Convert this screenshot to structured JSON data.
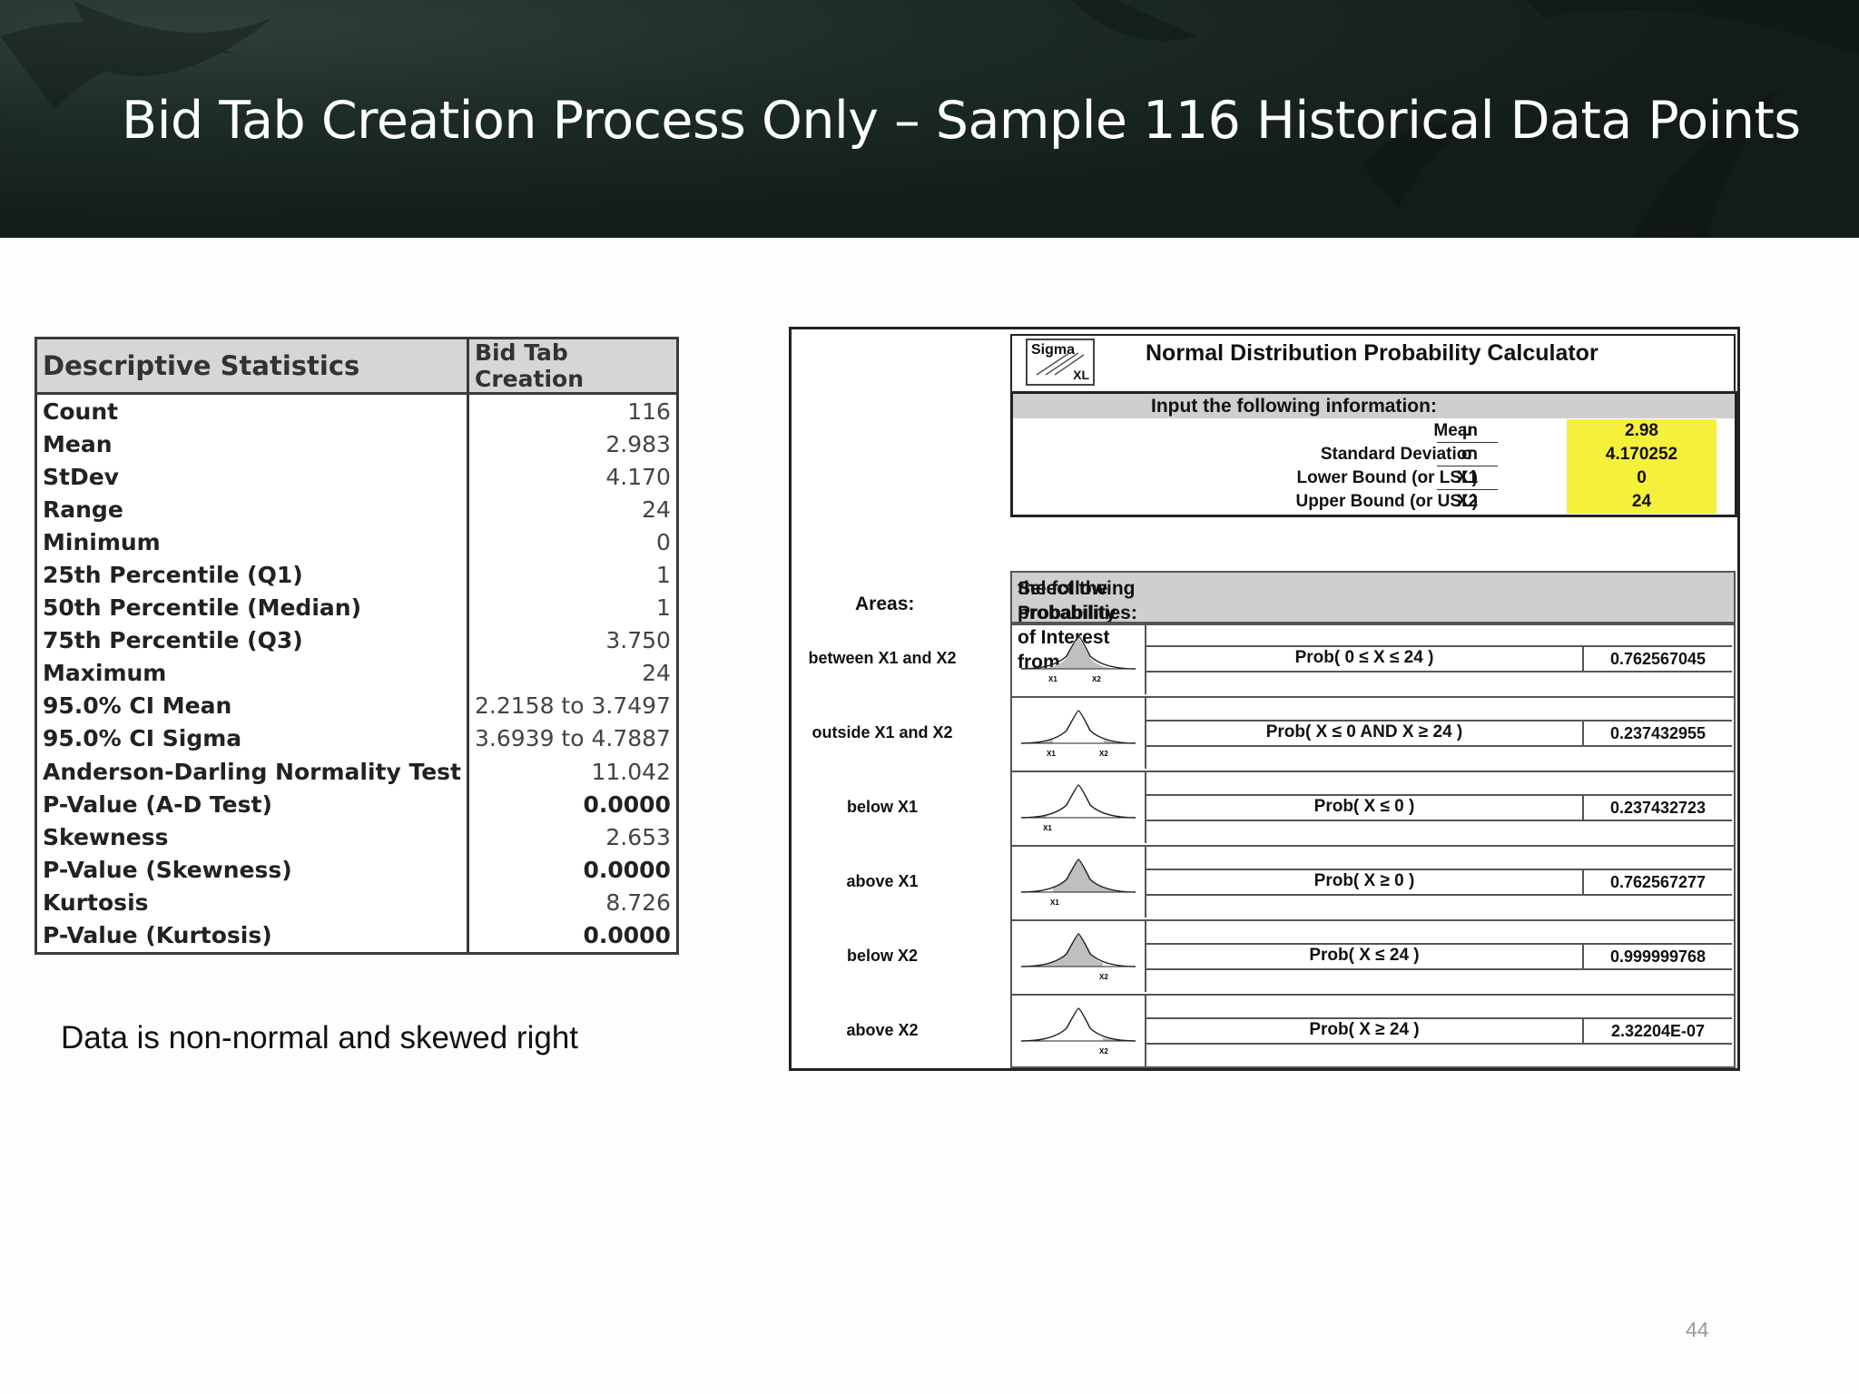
{
  "slide": {
    "title": "Bid Tab Creation Process Only – Sample 116 Historical Data Points",
    "note": "Data is non-normal and skewed right",
    "page_number": "44"
  },
  "desc_stats": {
    "header_label": "Descriptive Statistics",
    "header_value": "Bid Tab Creation",
    "rows": [
      {
        "label": "Count",
        "value": "116"
      },
      {
        "label": "Mean",
        "value": "2.983"
      },
      {
        "label": "StDev",
        "value": "4.170"
      },
      {
        "label": "Range",
        "value": "24"
      },
      {
        "label": "Minimum",
        "value": "0"
      },
      {
        "label": "25th Percentile (Q1)",
        "value": "1"
      },
      {
        "label": "50th Percentile (Median)",
        "value": "1"
      },
      {
        "label": "75th Percentile (Q3)",
        "value": "3.750"
      },
      {
        "label": "Maximum",
        "value": "24"
      },
      {
        "label": "95.0% CI Mean",
        "value": "2.2158 to 3.7497"
      },
      {
        "label": "95.0% CI Sigma",
        "value": "3.6939 to 4.7887"
      },
      {
        "label": "Anderson-Darling Normality Test",
        "value": "11.042"
      },
      {
        "label": "P-Value (A-D Test)",
        "value": "0.0000"
      },
      {
        "label": "Skewness",
        "value": "2.653"
      },
      {
        "label": "P-Value (Skewness)",
        "value": "0.0000"
      },
      {
        "label": "Kurtosis",
        "value": "8.726"
      },
      {
        "label": "P-Value (Kurtosis)",
        "value": "0.0000"
      }
    ]
  },
  "calculator": {
    "logo_top": "Sigma",
    "logo_bottom": "XL",
    "title": "Normal Distribution Probability Calculator",
    "input_header": "Input the following information:",
    "inputs": [
      {
        "label": "Mean",
        "symbol": "µ",
        "value": "2.98"
      },
      {
        "label": "Standard Deviation",
        "symbol": "σ",
        "value": "4.170252"
      },
      {
        "label": "Lower Bound (or LSL)",
        "symbol": "X1",
        "value": "0"
      },
      {
        "label": "Upper Bound (or USL)",
        "symbol": "X2",
        "value": "24"
      }
    ],
    "prob_header_line1": "Select the Probability of Interest from",
    "prob_header_line2": "the following probabilities:",
    "areas_label": "Areas:",
    "rows": [
      {
        "area": "between X1 and X2",
        "expr": "Prob( 0 ≤ X ≤ 24 )",
        "result": "0.762567045",
        "curve_labels": "X1   X2"
      },
      {
        "area": "outside X1 and X2",
        "expr": "Prob( X ≤ 0  AND X ≥ 24 )",
        "result": "0.237432955",
        "curve_labels": "X1   X2"
      },
      {
        "area": "below X1",
        "expr": "Prob( X ≤ 0 )",
        "result": "0.237432723",
        "curve_labels": "X1"
      },
      {
        "area": "above X1",
        "expr": "Prob( X ≥ 0 )",
        "result": "0.762567277",
        "curve_labels": "X1"
      },
      {
        "area": "below X2",
        "expr": "Prob( X ≤ 24 )",
        "result": "0.999999768",
        "curve_labels": "X2"
      },
      {
        "area": "above X2",
        "expr": "Prob( X ≥ 24 )",
        "result": "2.32204E-07",
        "curve_labels": "X2"
      }
    ],
    "colors": {
      "input_highlight": "#f5f03a",
      "header_gray": "#cfcfcf"
    }
  }
}
